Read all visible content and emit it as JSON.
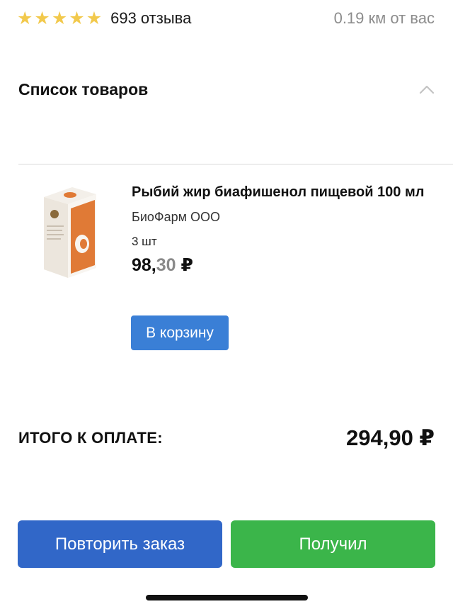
{
  "rating": {
    "stars": [
      "★",
      "★",
      "★",
      "★",
      "★"
    ],
    "value": 5,
    "reviews_text": "693 отзыва",
    "distance_text": "0.19 км от вас",
    "star_color": "#f2c94c"
  },
  "section": {
    "title": "Список товаров",
    "toggle_icon": "chevron-up-icon",
    "expanded": true
  },
  "product": {
    "name": "Рыбий жир биафишенол пищевой 100 мл",
    "manufacturer": "БиоФарм ООО",
    "quantity": "3 шт",
    "price_rub": "98,",
    "price_kop": "30",
    "currency": "₽",
    "add_to_cart_label": "В корзину",
    "image_icon": "product-box-image"
  },
  "total": {
    "label": "ИТОГО К ОПЛАТЕ:",
    "value": "294,90 ₽"
  },
  "actions": {
    "repeat_label": "Повторить заказ",
    "received_label": "Получил"
  },
  "colors": {
    "accent_blue": "#3a7fd6",
    "repeat_blue": "#3167c8",
    "received_green": "#3bb54a",
    "muted_gray": "#8c8c8c"
  }
}
